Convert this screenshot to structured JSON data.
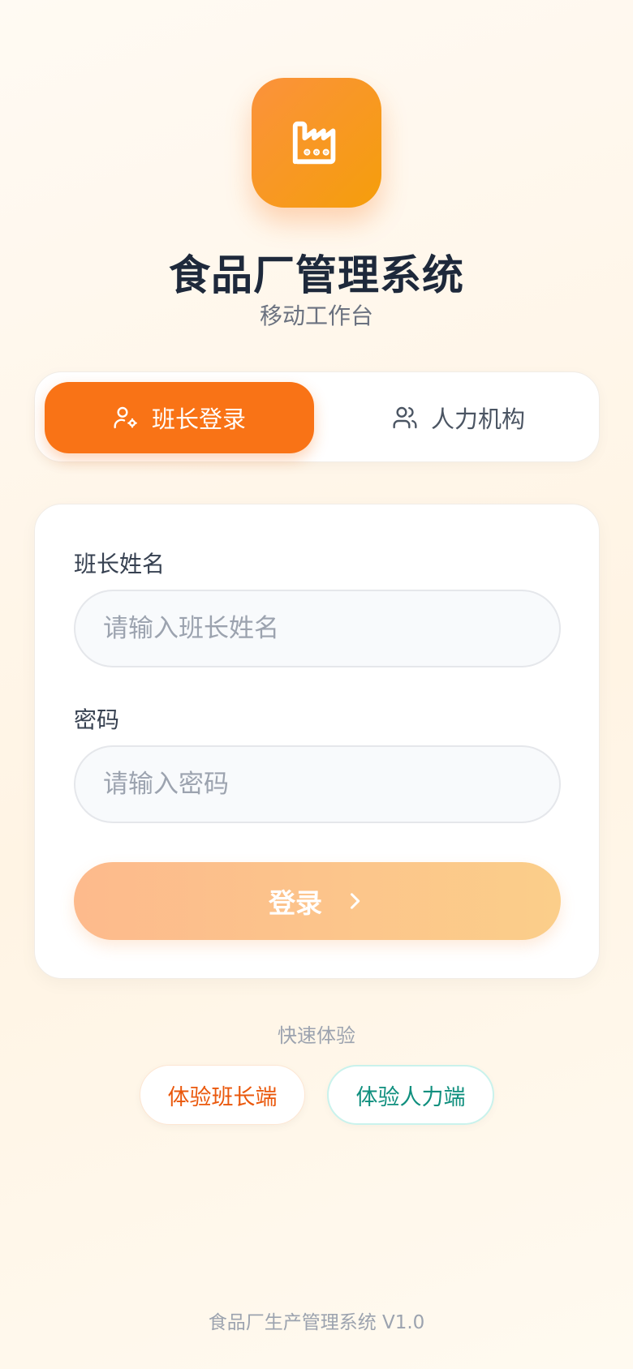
{
  "app": {
    "title": "食品厂管理系统",
    "subtitle": "移动工作台",
    "logo_icon": "factory-icon"
  },
  "role_tabs": [
    {
      "label": "班长登录",
      "icon": "user-gear-icon",
      "active": true
    },
    {
      "label": "人力机构",
      "icon": "users-icon",
      "active": false
    }
  ],
  "form": {
    "name_label": "班长姓名",
    "name_placeholder": "请输入班长姓名",
    "name_value": "",
    "password_label": "密码",
    "password_placeholder": "请输入密码",
    "password_value": "",
    "login_label": "登录",
    "login_icon": "chevron-right-icon"
  },
  "quick": {
    "label": "快速体验",
    "leader_label": "体验班长端",
    "hr_label": "体验人力端"
  },
  "footer": {
    "text": "食品厂生产管理系统 V1.0"
  },
  "colors": {
    "accent": "#f97316",
    "accent_light": "#fdba8c",
    "teal": "#0f8f7e",
    "title": "#1e293b"
  }
}
